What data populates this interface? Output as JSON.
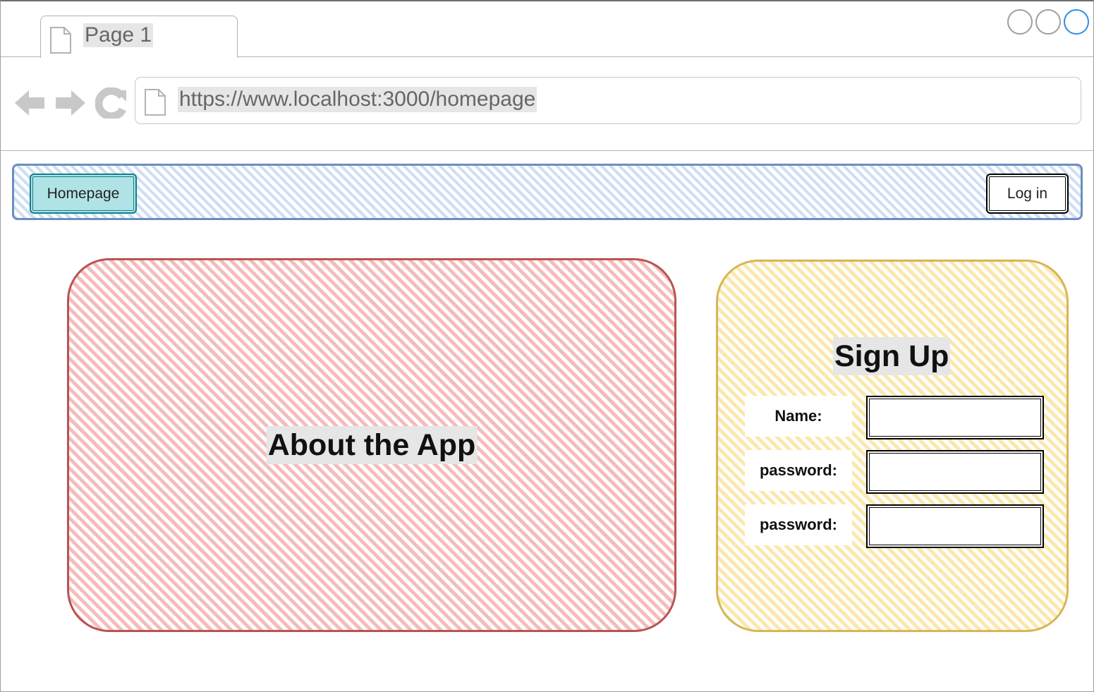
{
  "browser": {
    "tab_title": "Page 1",
    "url": "https://www.localhost:3000/homepage",
    "window_controls": [
      "circle",
      "circle",
      "circle"
    ]
  },
  "navbar": {
    "homepage_label": "Homepage",
    "login_label": "Log in"
  },
  "about": {
    "title": "About the App"
  },
  "signup": {
    "title": "Sign Up",
    "fields": [
      {
        "label": "Name:",
        "value": ""
      },
      {
        "label": "password:",
        "value": ""
      },
      {
        "label": "password:",
        "value": ""
      }
    ]
  },
  "colors": {
    "navbar_border": "#6c8ebf",
    "navbar_fill": "#dae8fc",
    "homepage_button_fill": "#b0e3e6",
    "homepage_button_border": "#0e8088",
    "about_border": "#b85450",
    "about_fill": "#f8cecc",
    "signup_border": "#d6b656",
    "signup_fill": "#fff2cc",
    "active_window_control": "#2f8de4"
  }
}
